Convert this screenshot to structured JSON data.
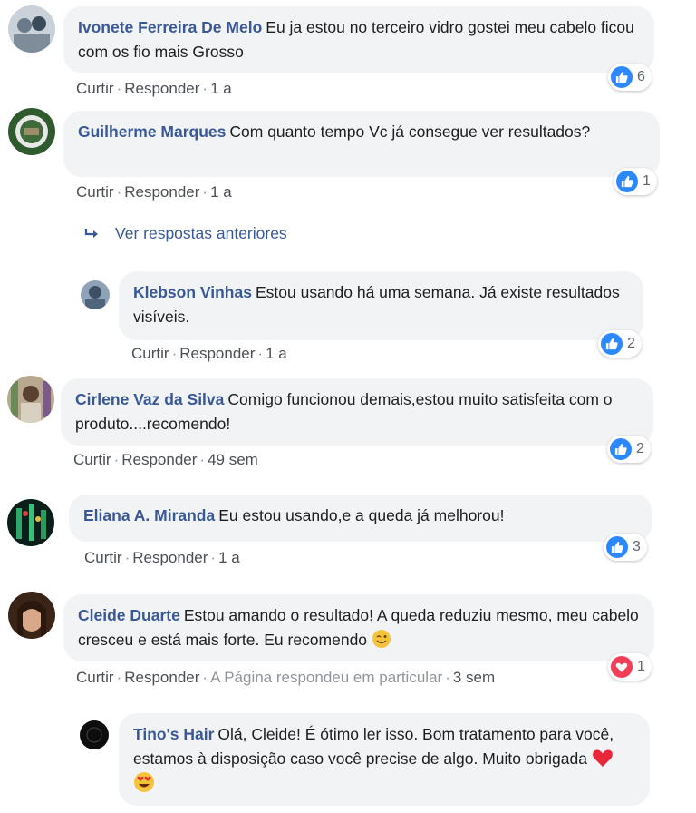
{
  "comments": [
    {
      "author": "Ivonete Ferreira De Melo",
      "text": "Eu ja estou no terceiro vidro gostei meu cabelo ficou com os fio mais Grosso",
      "like": "Curtir",
      "reply": "Responder",
      "time": "1 a",
      "reactions": "6",
      "avatar_color": "#9aa7b4"
    },
    {
      "author": "Guilherme Marques",
      "text": "Com quanto tempo Vc já consegue ver resultados?",
      "like": "Curtir",
      "reply": "Responder",
      "time": "1 a",
      "reactions": "1",
      "avatar_color": "#3f6b3a"
    },
    {
      "author": "Klebson Vinhas",
      "text": "Estou usando há uma semana. Já existe resultados visíveis.",
      "like": "Curtir",
      "reply": "Responder",
      "time": "1 a",
      "reactions": "2",
      "avatar_color": "#5b6f86"
    },
    {
      "author": "Cirlene Vaz da Silva",
      "text": "Comigo funcionou demais,estou muito satisfeita com o produto....recomendo!",
      "like": "Curtir",
      "reply": "Responder",
      "time": "49 sem",
      "reactions": "2",
      "avatar_color": "#8a7a6a"
    },
    {
      "author": "Eliana A. Miranda",
      "text": "Eu estou usando,e a queda já melhorou!",
      "like": "Curtir",
      "reply": "Responder",
      "time": "1 a",
      "reactions": "3",
      "avatar_color": "#0f2a22"
    },
    {
      "author": "Cleide Duarte",
      "text": "Estou amando o resultado! A queda reduziu mesmo, meu cabelo cresceu e está mais forte. Eu recomendo",
      "like": "Curtir",
      "reply": "Responder",
      "page_replied": "A Página respondeu em particular",
      "time": "3 sem",
      "reactions": "1",
      "avatar_color": "#5a3b2a"
    },
    {
      "author": "Tino's Hair",
      "text": "Olá, Cleide! É ótimo ler isso. Bom tratamento para você, estamos à disposição caso você precise de algo. Muito obrigada",
      "avatar_color": "#111111"
    }
  ],
  "view_previous": "Ver respostas anteriores",
  "colors": {
    "author": "#385898",
    "bubble": "#f2f3f5",
    "like": "#2d88ff",
    "love": "#f33e58"
  },
  "icons": [
    "reply-arrow-icon",
    "like-icon",
    "love-icon",
    "wink-emoji",
    "heart-emoji",
    "heart-eyes-emoji"
  ]
}
